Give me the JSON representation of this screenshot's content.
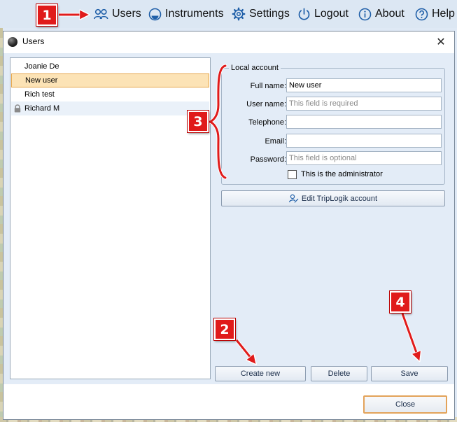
{
  "menu": {
    "users": "Users",
    "instruments": "Instruments",
    "settings": "Settings",
    "logout": "Logout",
    "about": "About",
    "help": "Help"
  },
  "dialog": {
    "title": "Users",
    "close_glyph": "✕"
  },
  "users": [
    {
      "name": "Joanie De",
      "selected": false,
      "locked": false
    },
    {
      "name": "New user",
      "selected": true,
      "locked": false
    },
    {
      "name": "Rich test",
      "selected": false,
      "locked": false
    },
    {
      "name": "Richard M",
      "selected": false,
      "locked": true
    }
  ],
  "local_account": {
    "legend": "Local account",
    "full_name_label": "Full name:",
    "full_name_value": "New user",
    "user_name_label": "User name:",
    "user_name_placeholder": "This field is required",
    "telephone_label": "Telephone:",
    "telephone_value": "",
    "email_label": "Email:",
    "email_value": "",
    "password_label": "Password:",
    "password_placeholder": "This field is optional",
    "admin_label": "This is the administrator",
    "admin_checked": false
  },
  "buttons": {
    "edit_account": "Edit TripLogik account",
    "create_new": "Create new",
    "delete": "Delete",
    "save": "Save",
    "close": "Close"
  },
  "callouts": [
    "1",
    "2",
    "3",
    "4"
  ],
  "colors": {
    "callout": "#e01b1b",
    "selected_row": "#fce3b6",
    "selected_border": "#e6a64a",
    "panel": "#e3ecf7",
    "icon_blue": "#1f5fa8"
  }
}
